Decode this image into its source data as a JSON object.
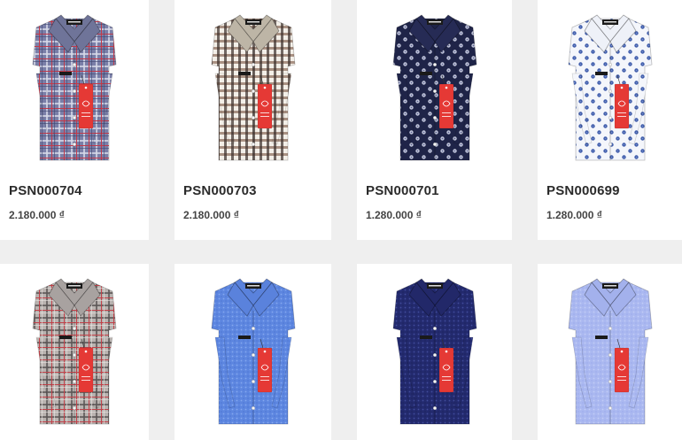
{
  "products": [
    {
      "sku": "PSN000704",
      "price": "2.180.000 ₫",
      "shirt_pattern": "plaid-check",
      "colors": {
        "base": "#7a7fa8",
        "line1": "#c23a4a",
        "line2": "#d8dbe8",
        "line3": "#3d4470",
        "collar": "#6f7499"
      }
    },
    {
      "sku": "PSN000703",
      "price": "2.180.000 ₫",
      "shirt_pattern": "gingham-check",
      "colors": {
        "base": "#d8d2c6",
        "line1": "#3a2e2a",
        "line2": "#8a6a58",
        "line3": "#f3efe8",
        "collar": "#bdb5a6"
      }
    },
    {
      "sku": "PSN000701",
      "price": "1.280.000 ₫",
      "shirt_pattern": "dot-print",
      "colors": {
        "base": "#1f2448",
        "line1": "#c9cde0",
        "line2": "#5a6090",
        "line3": "#12162e",
        "collar": "#262b55"
      }
    },
    {
      "sku": "PSN000699",
      "price": "1.280.000 ₫",
      "shirt_pattern": "dot-print",
      "colors": {
        "base": "#f4f6fb",
        "line1": "#3a58a8",
        "line2": "#7a92cf",
        "line3": "#dfe4f2",
        "collar": "#eef1f8"
      }
    },
    {
      "sku": "",
      "price": "",
      "shirt_pattern": "plaid-check",
      "colors": {
        "base": "#b9b3b0",
        "line1": "#c04048",
        "line2": "#5b5656",
        "line3": "#ece8e6",
        "collar": "#a8a2a0"
      }
    },
    {
      "sku": "",
      "price": "",
      "shirt_pattern": "micro-dot",
      "colors": {
        "base": "#5d86e0",
        "line1": "#8fb0f2",
        "line2": "#3f68c6",
        "line3": "#4a74d6",
        "collar": "#5a82dc"
      }
    },
    {
      "sku": "",
      "price": "",
      "shirt_pattern": "micro-dot",
      "colors": {
        "base": "#232a6e",
        "line1": "#4a55a8",
        "line2": "#161b4e",
        "line3": "#2b3280",
        "collar": "#222869"
      }
    },
    {
      "sku": "",
      "price": "",
      "shirt_pattern": "micro-dot",
      "colors": {
        "base": "#aab8f0",
        "line1": "#c8d2f7",
        "line2": "#8e9ee6",
        "line3": "#b3c0f2",
        "collar": "#a3b1ec"
      }
    }
  ],
  "tag_color": "#e53935",
  "accent": "#ffffff"
}
